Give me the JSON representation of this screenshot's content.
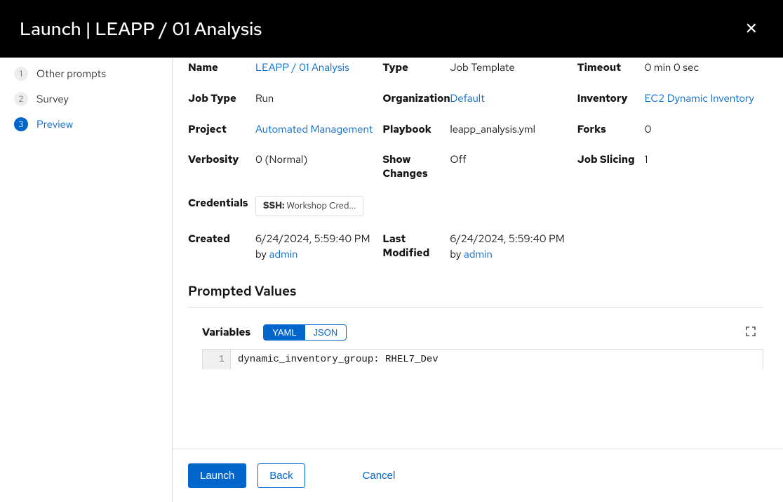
{
  "header": {
    "title": "Launch | LEAPP / 01 Analysis"
  },
  "steps": [
    {
      "num": "1",
      "label": "Other prompts",
      "active": false
    },
    {
      "num": "2",
      "label": "Survey",
      "active": false
    },
    {
      "num": "3",
      "label": "Preview",
      "active": true
    }
  ],
  "details": {
    "name": {
      "label": "Name",
      "value": "LEAPP / 01 Analysis",
      "link": true
    },
    "type": {
      "label": "Type",
      "value": "Job Template"
    },
    "timeout": {
      "label": "Timeout",
      "value": "0 min 0 sec"
    },
    "jobType": {
      "label": "Job Type",
      "value": "Run"
    },
    "organization": {
      "label": "Organization",
      "value": "Default",
      "link": true
    },
    "inventory": {
      "label": "Inventory",
      "value": "EC2 Dynamic Inventory",
      "link": true
    },
    "project": {
      "label": "Project",
      "value": "Automated Management",
      "link": true
    },
    "playbook": {
      "label": "Playbook",
      "value": "leapp_analysis.yml"
    },
    "forks": {
      "label": "Forks",
      "value": "0"
    },
    "verbosity": {
      "label": "Verbosity",
      "value": "0 (Normal)"
    },
    "showChanges": {
      "label": "Show Changes",
      "value": "Off"
    },
    "jobSlicing": {
      "label": "Job Slicing",
      "value": "1"
    },
    "credentials": {
      "label": "Credentials",
      "chipType": "SSH:",
      "chipValue": " Workshop Cred..."
    },
    "created": {
      "label": "Created",
      "prefix": "6/24/2024, 5:59:40 PM by ",
      "user": "admin"
    },
    "modified": {
      "label": "Last Modified",
      "prefix": "6/24/2024, 5:59:40 PM by ",
      "user": "admin"
    }
  },
  "prompted": {
    "section_title": "Prompted Values",
    "variables_label": "Variables",
    "toggle_yaml": "YAML",
    "toggle_json": "JSON",
    "line_number": "1",
    "code": "dynamic_inventory_group: RHEL7_Dev"
  },
  "footer": {
    "launch": "Launch",
    "back": "Back",
    "cancel": "Cancel"
  }
}
